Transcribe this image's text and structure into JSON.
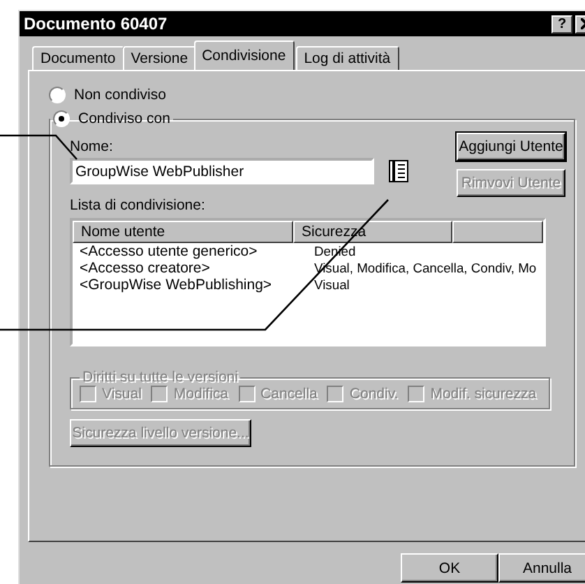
{
  "window": {
    "title": "Documento 60407",
    "help": "?"
  },
  "tabs": [
    {
      "label": "Documento",
      "selected": false
    },
    {
      "label": "Versione",
      "selected": false
    },
    {
      "label": "Condivisione",
      "selected": true
    },
    {
      "label": "Log di attività",
      "selected": false
    }
  ],
  "sharing": {
    "options": [
      {
        "label": "Non condiviso",
        "selected": false
      },
      {
        "label": "Condiviso con",
        "selected": true
      }
    ],
    "name_field": {
      "label": "Nome:",
      "value": "GroupWise WebPublisher"
    },
    "add_button": {
      "label": "Aggiungi Utente",
      "disabled": false
    },
    "remove_button": {
      "label": "Rimvovi Utente",
      "disabled": true
    },
    "share_list": {
      "label": "Lista di condivisione:",
      "columns": [
        "Nome utente",
        "Sicurezza"
      ],
      "rows": [
        {
          "user": "<Accesso utente generico>",
          "security": "Denied"
        },
        {
          "user": "<Accesso creatore>",
          "security": "Visual, Modifica, Cancella, Condiv, Mo"
        },
        {
          "user": "<GroupWise WebPublishing>",
          "security": "Visual"
        }
      ]
    },
    "rights_group": {
      "title": "Diritti su tutte le versioni",
      "disabled": true,
      "checkboxes": [
        {
          "label": "Visual",
          "checked": false
        },
        {
          "label": "Modifica",
          "checked": false
        },
        {
          "label": "Cancella",
          "checked": false
        },
        {
          "label": "Condiv.",
          "checked": false
        },
        {
          "label": "Modif. sicurezza",
          "checked": false
        }
      ]
    },
    "version_security_button": {
      "label": "Sicurezza livello versione...",
      "disabled": true
    }
  },
  "footer_buttons": [
    {
      "label": "OK"
    },
    {
      "label": "Annulla"
    }
  ]
}
